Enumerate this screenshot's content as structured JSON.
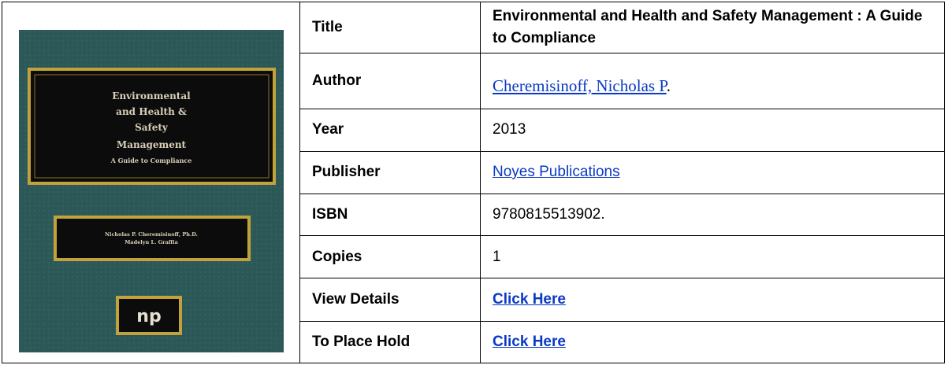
{
  "cover": {
    "title_lines": [
      "Environmental",
      "and Health &",
      "Safety",
      "Management"
    ],
    "subtitle": "A Guide to Compliance",
    "authors": [
      "Nicholas P. Cheremisinoff, Ph.D.",
      "Madelyn L. Graffia"
    ],
    "publisher_logo": "np",
    "colors": {
      "background": "#2e5c5c",
      "panel": "#0c0c0c",
      "border": "#c2a23c",
      "text": "#d8d0b8"
    }
  },
  "rows": [
    {
      "label": "Title",
      "value": "Environmental and Health and Safety Management : A Guide to Compliance"
    },
    {
      "label": "Author",
      "value": "Cheremisinoff, Nicholas P",
      "suffix": "."
    },
    {
      "label": "Year",
      "value": "2013"
    },
    {
      "label": "Publisher",
      "value": "Noyes Publications"
    },
    {
      "label": "ISBN",
      "value": "9780815513902."
    },
    {
      "label": "Copies",
      "value": "1"
    },
    {
      "label": "View Details",
      "value": "Click Here"
    },
    {
      "label": "To Place Hold",
      "value": "Click Here"
    }
  ],
  "colors": {
    "link": "#0a39c4",
    "border": "#000000"
  }
}
